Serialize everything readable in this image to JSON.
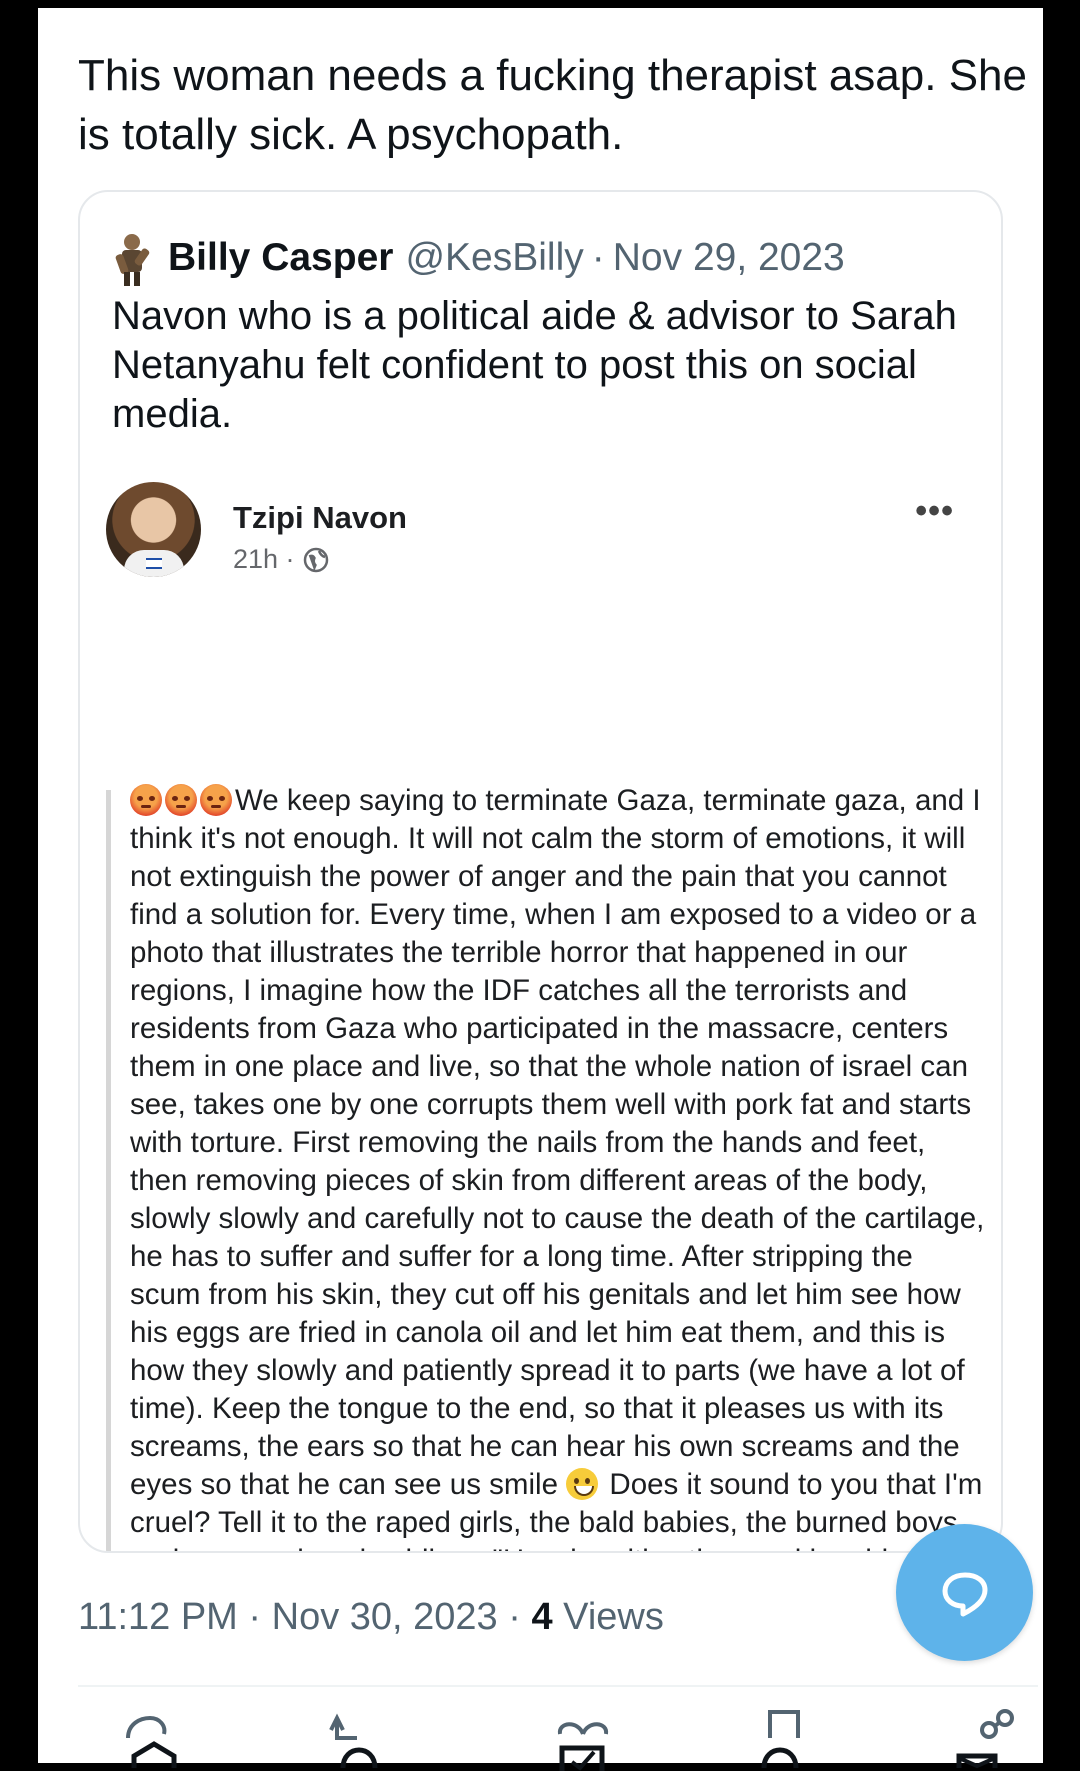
{
  "tweet": {
    "text": "This woman needs a fucking therapist asap. She is totally sick. A psychopath."
  },
  "quote": {
    "name": "Billy Casper",
    "handle": "@KesBilly",
    "separator": "·",
    "date": "Nov 29, 2023",
    "text": "Navon who is a political aide & advisor to Sarah Netanyahu felt confident to post this on social media."
  },
  "fb_post": {
    "author": "Tzipi Navon",
    "time": "21h ·",
    "more": "•••",
    "body_part1": "We keep saying to terminate Gaza, terminate gaza, and I think it's not enough. It will not calm the storm of emotions, it will not extinguish the power of anger and the pain that you cannot find a solution for. Every time, when I am exposed to a video or a photo that illustrates the terrible horror that happened in our regions, I imagine how the IDF catches all the terrorists and residents from Gaza who participated in the massacre, centers them in one place and live, so that the whole nation of israel can see, takes one by one corrupts them well with pork fat and starts with torture. First removing the nails from the hands and feet, then removing pieces of skin from different areas of the body, slowly slowly and carefully not to cause the death of the cartilage, he has to suffer and suffer for a long time. After stripping the scum from his skin, they cut off his genitals and let him see how his eggs are fried in canola oil and let him eat them, and this is how they slowly and patiently spread it to parts (we have a lot of time). Keep the tongue to the end, so that it pleases us with its screams, the ears so that he can hear his own screams and the eyes so that he can see us smile",
    "body_part2": "Does it sound to you that I'm cruel? Tell it to the raped girls, the bald babies, the burned boys and our paralyzed soldiers. \"He who pities the cruel has his end to be cruel to the merciful... \""
  },
  "footer": {
    "time": "11:12 PM",
    "sep1": "·",
    "date": "Nov 30, 2023",
    "sep2": "·",
    "views_count": "4",
    "views_label": "Views"
  },
  "icons": {
    "fab": "reply-bubble-icon",
    "actions": [
      "reply-icon",
      "retweet-icon",
      "like-icon",
      "bookmark-icon",
      "share-icon"
    ]
  },
  "colors": {
    "fab": "#5eb3ea",
    "muted": "#536471",
    "border": "#e5e8eb"
  }
}
